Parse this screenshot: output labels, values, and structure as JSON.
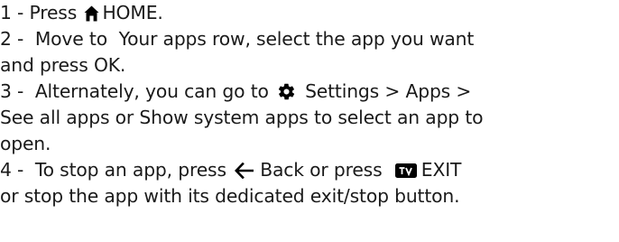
{
  "steps": {
    "s1": {
      "num": "1 -",
      "a": "Press",
      "home_label": "HOME",
      "end": "."
    },
    "s2": {
      "num": "2 -",
      "a": "Move to",
      "your_apps": "Your apps",
      "b": "row, select the app you want",
      "c": "and press",
      "ok": "OK",
      "end": "."
    },
    "s3": {
      "num": "3 -",
      "a": "Alternately, you can go to",
      "settings": "Settings",
      "sep1": ">",
      "apps": "Apps",
      "sep2": ">",
      "see_all": "See all apps",
      "or": "or",
      "show_system": "Show system apps",
      "b": "to select an app to",
      "c": "open."
    },
    "s4": {
      "num": "4 -",
      "a": "To stop an app, press",
      "back": "Back",
      "or_press": "or press",
      "exit": "EXIT",
      "b": "or stop the app with its dedicated exit/stop button."
    }
  },
  "icons": {
    "home": "home-icon",
    "settings": "gear-icon",
    "back": "back-arrow-icon",
    "tv": "tv-icon"
  },
  "colors": {
    "text": "#1a1a1a",
    "icon": "#000000"
  }
}
